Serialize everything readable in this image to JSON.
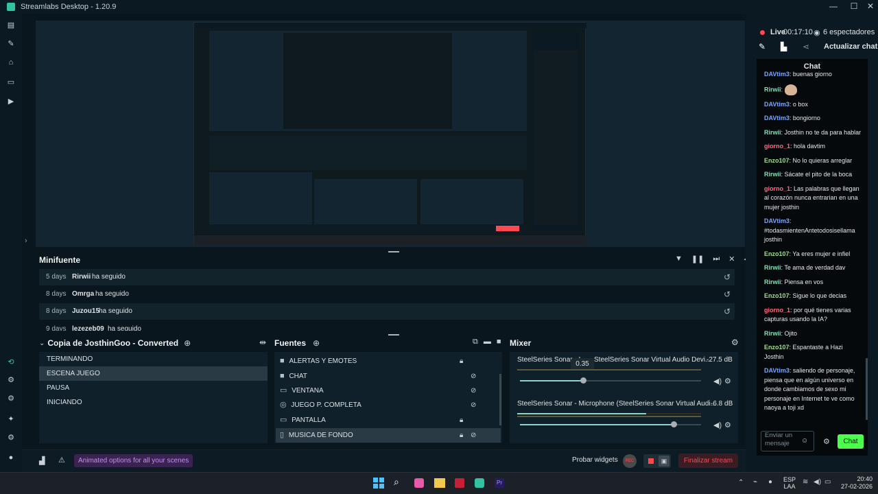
{
  "window": {
    "title": "Streamlabs Desktop - 1.20.9"
  },
  "leftnav": {
    "icons": [
      "editor-icon",
      "themes-icon",
      "store-icon",
      "layout-icon",
      "play-icon",
      "studio-mode-icon",
      "settings-icon",
      "layout-editor-icon",
      "sparkle-icon",
      "gear-icon",
      "profile-icon"
    ]
  },
  "minifeed": {
    "title": "Minifuente",
    "events": [
      {
        "time": "5 days",
        "user": "Rirwii",
        "action": "ha seguido"
      },
      {
        "time": "8 days",
        "user": "Omrga",
        "action": "ha seguido"
      },
      {
        "time": "8 days",
        "user": "Juzou15",
        "action": "ha seguido"
      },
      {
        "time": "9 days",
        "user": "lezezeb09",
        "action": "ha seguido"
      }
    ]
  },
  "scenes": {
    "title": "Copia de JosthinGoo - Converted",
    "items": [
      "TERMINANDO",
      "ESCENA JUEGO",
      "PAUSA",
      "INICIANDO"
    ],
    "selected": "ESCENA JUEGO"
  },
  "sources": {
    "title": "Fuentes",
    "items": [
      {
        "name": "ALERTAS Y EMOTES",
        "icon": "folder-icon"
      },
      {
        "name": "CHAT",
        "icon": "folder-icon"
      },
      {
        "name": "VENTANA",
        "icon": "window-icon"
      },
      {
        "name": "JUEGO P. COMPLETA",
        "icon": "gamepad-icon"
      },
      {
        "name": "PANTALLA",
        "icon": "monitor-icon"
      },
      {
        "name": "MUSICA DE FONDO",
        "icon": "file-icon"
      }
    ]
  },
  "mixer": {
    "title": "Mixer",
    "tooltip": "0.35",
    "tracks": [
      {
        "name": "SteelSeries Sonar - I",
        "name_full": "SteelSeries Sonar Virtual Audio Devi...",
        "db": "-27.5 dB",
        "volume": 0.35,
        "meter": 0.0
      },
      {
        "name": "SteelSeries Sonar - Microphone (SteelSeries Sonar Virtual Audi...",
        "db": "-6.8 dB",
        "volume": 0.85,
        "meter": 0.7
      }
    ]
  },
  "bottombar": {
    "promo": "Animated options for all your scenes",
    "test_widgets": "Probar widgets",
    "test_badge": "REC",
    "end_stream": "Finalizar stream"
  },
  "right": {
    "live": "Live",
    "uptime": "00:17:10",
    "viewers": "6 espectadores",
    "refresh_chat": "Actualizar chat",
    "chat_title": "Chat",
    "input_placeholder": "Enviar un mensaje",
    "chat_button": "Chat",
    "messages": [
      {
        "user": "DAVtim3",
        "text": "buenas giorno",
        "color": "#7aa7ff"
      },
      {
        "user": "Rirwii",
        "text": "",
        "color": "#7de3b8",
        "emote": true
      },
      {
        "user": "DAVtim3",
        "text": "o box",
        "color": "#7aa7ff"
      },
      {
        "user": "DAVtim3",
        "text": "bongiorno",
        "color": "#7aa7ff"
      },
      {
        "user": "Rirwii",
        "text": "Josthin no te da para hablar",
        "color": "#7de3b8"
      },
      {
        "user": "giorno_1",
        "text": "hola davtim",
        "color": "#ff6b81"
      },
      {
        "user": "Enzo107",
        "text": "No lo quieras arreglar",
        "color": "#9ee08f"
      },
      {
        "user": "Rirwii",
        "text": "Sácate el pito de la boca",
        "color": "#7de3b8"
      },
      {
        "user": "giorno_1",
        "text": "Las palabras que llegan al corazón nunca entrarian en una mujer josthin",
        "color": "#ff6b81"
      },
      {
        "user": "DAVtim3",
        "text": "#todasmientenAntetodosisellama josthin",
        "color": "#7aa7ff"
      },
      {
        "user": "Enzo107",
        "text": "Ya eres mujer e infiel",
        "color": "#9ee08f"
      },
      {
        "user": "Rirwii",
        "text": "Te ama de verdad dav",
        "color": "#7de3b8"
      },
      {
        "user": "Rirwii",
        "text": "Piensa en vos",
        "color": "#7de3b8"
      },
      {
        "user": "Enzo107",
        "text": "Sigue lo que decias",
        "color": "#9ee08f"
      },
      {
        "user": "giorno_1",
        "text": "por qué tienes varias capturas usando la IA?",
        "color": "#ff6b81"
      },
      {
        "user": "Rirwii",
        "text": "Ojito",
        "color": "#7de3b8"
      },
      {
        "user": "Enzo107",
        "text": "Espantaste a Hazi Josthin",
        "color": "#9ee08f"
      },
      {
        "user": "DAVtim3",
        "text": "saliendo de personaje, piensa que en algún universo en donde cambiamos de sexo mi personaje en Internet te ve como naoya a toji xd",
        "color": "#7aa7ff"
      }
    ]
  },
  "taskbar": {
    "lang1": "ESP",
    "lang2": "LAA",
    "time": "20:40",
    "date": "27-02-2026"
  },
  "colors": {
    "accent": "#31c3a2",
    "red": "#ff4950",
    "green": "#4cff4c",
    "bg": "#09161d"
  }
}
